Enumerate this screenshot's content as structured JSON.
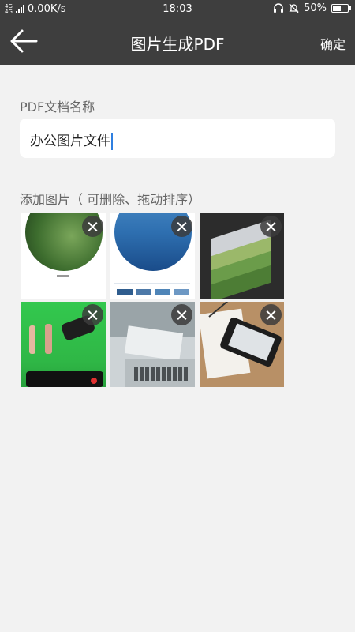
{
  "status_bar": {
    "network_type_top": "4G",
    "network_type_bottom": "4G",
    "speed": "0.00K/s",
    "time": "18:03",
    "battery": "50%",
    "battery_level": 0.5
  },
  "header": {
    "title": "图片生成PDF",
    "confirm_label": "确定",
    "back_icon": "arrow-left-icon"
  },
  "form": {
    "name_label": "PDF文档名称",
    "name_value": "办公图片文件",
    "images_label": "添加图片（ 可删除、拖动排序）"
  },
  "images": [
    {
      "name": "tea-garden-circle"
    },
    {
      "name": "blue-lake-circle"
    },
    {
      "name": "stacked-layers"
    },
    {
      "name": "greenscreen-dancers"
    },
    {
      "name": "laptop-notebook-desk"
    },
    {
      "name": "phone-on-notebook"
    }
  ],
  "colors": {
    "header_bg": "#3e3e3e",
    "page_bg": "#f2f2f2",
    "caret": "#2f7fe0"
  }
}
